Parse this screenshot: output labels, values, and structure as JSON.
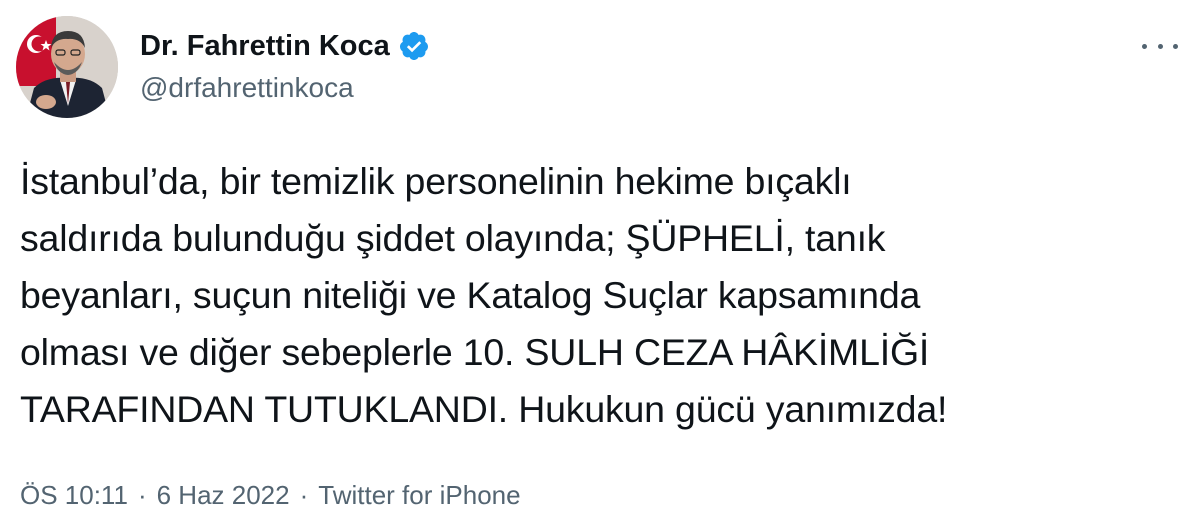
{
  "author": {
    "display_name": "Dr. Fahrettin Koca",
    "handle": "@drfahrettinkoca",
    "verified": true,
    "verified_icon": "verified-badge-icon",
    "verified_color": "#1d9bf0"
  },
  "menu_icon": "more-options-icon",
  "tweet": {
    "text": "İstanbul’da, bir temizlik personelinin hekime bıçaklı\nsaldırıda bulunduğu şiddet olayında; ŞÜPHELİ, tanık\nbeyanları, suçun niteliği ve Katalog Suçlar kapsamında\nolması ve diğer sebeplerle 10. SULH CEZA HÂKİMLİĞİ\nTARAFINDAN TUTUKLANDI. Hukukun gücü yanımızda!"
  },
  "meta": {
    "time": "ÖS 10:11",
    "separator": "·",
    "date": "6 Haz 2022",
    "source": "Twitter for iPhone"
  }
}
